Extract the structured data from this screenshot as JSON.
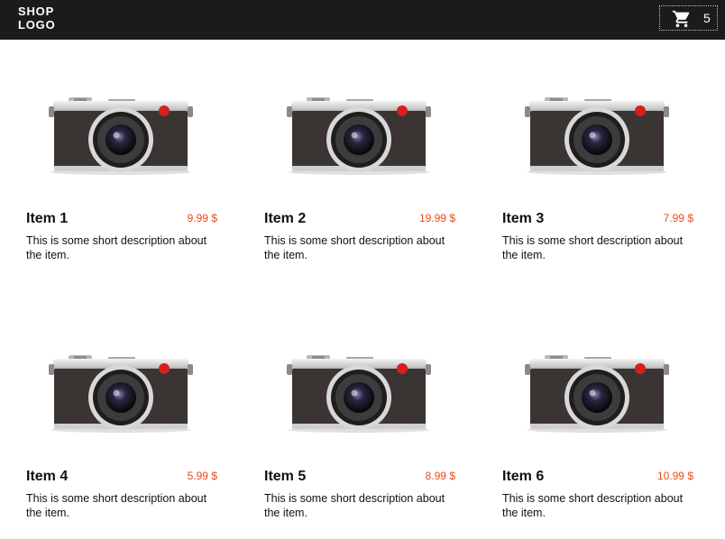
{
  "header": {
    "logo_line1": "SHOP",
    "logo_line2": "LOGO",
    "cart_icon": "shopping-cart-icon",
    "cart_count": "5"
  },
  "colors": {
    "header_bg": "#1b1b1b",
    "price": "#e74c1c"
  },
  "products": [
    {
      "name": "Item 1",
      "price": "9.99 $",
      "description": "This is some short description about the item.",
      "image_icon": "camera-icon"
    },
    {
      "name": "Item 2",
      "price": "19.99 $",
      "description": "This is some short description about the item.",
      "image_icon": "camera-icon"
    },
    {
      "name": "Item 3",
      "price": "7.99 $",
      "description": "This is some short description about the item.",
      "image_icon": "camera-icon"
    },
    {
      "name": "Item 4",
      "price": "5.99 $",
      "description": "This is some short description about the item.",
      "image_icon": "camera-icon"
    },
    {
      "name": "Item 5",
      "price": "8.99 $",
      "description": "This is some short description about the item.",
      "image_icon": "camera-icon"
    },
    {
      "name": "Item 6",
      "price": "10.99 $",
      "description": "This is some short description about the item.",
      "image_icon": "camera-icon"
    }
  ]
}
